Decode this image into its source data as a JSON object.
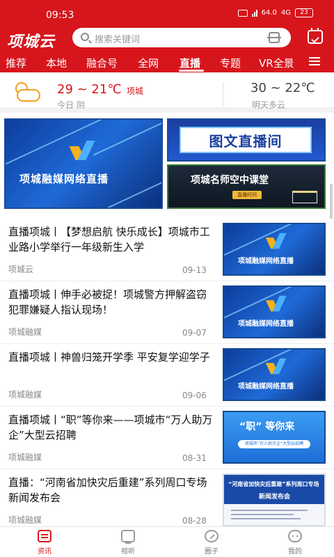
{
  "status_bar": {
    "time": "09:53",
    "battery": "23",
    "network": "4G",
    "speed": "64.0"
  },
  "app": {
    "logo": "项城云",
    "accent": "#d7151c"
  },
  "search": {
    "placeholder": "搜索关键词"
  },
  "tabs": [
    {
      "label": "推荐"
    },
    {
      "label": "本地"
    },
    {
      "label": "融合号"
    },
    {
      "label": "全网"
    },
    {
      "label": "直播",
      "active": true
    },
    {
      "label": "专题"
    },
    {
      "label": "VR全景"
    }
  ],
  "weather": {
    "today_temp": "29 ~ 21℃",
    "city": "项城",
    "today_desc": "今日 阴",
    "tomorrow_temp": "30 ~ 22℃",
    "tomorrow_desc": "明天多云"
  },
  "banners": {
    "main": "项城融媒网络直播",
    "top_right": "图文直播间",
    "bottom_right": "项城名师空中课堂",
    "bottom_right_tag": "直播时间"
  },
  "news": [
    {
      "title": "直播项城丨【梦想启航 快乐成长】项城市工业路小学举行一年级新生入学",
      "source": "项城云",
      "date": "09-13",
      "thumb": "项城融媒网络直播"
    },
    {
      "title": "直播项城丨伸手必被捉！项城警方押解盗窃犯罪嫌疑人指认现场！",
      "source": "项城融媒",
      "date": "09-07",
      "thumb": "项城融媒网络直播"
    },
    {
      "title": "直播项城丨神兽归笼开学季 平安复学迎学子",
      "source": "项城融媒",
      "date": "09-06",
      "thumb": "项城融媒网络直播"
    },
    {
      "title": "直播项城丨“职”等你来——项城市“万人助万企”大型云招聘",
      "source": "项城融媒",
      "date": "08-31",
      "thumb": "“职” 等你来",
      "thumb_sub": "项城市“万人助万企”大型云招聘"
    },
    {
      "title": "直播：“河南省加快灾后重建”系列周口专场新闻发布会",
      "source": "项城融媒",
      "date": "08-28",
      "thumb": "“河南省加快灾后重建”系列周口专场",
      "thumb_sub": "新闻发布会"
    }
  ],
  "bottom_nav": [
    {
      "label": "资讯",
      "icon": "news-icon",
      "active": true
    },
    {
      "label": "视听",
      "icon": "tv-icon"
    },
    {
      "label": "圈子",
      "icon": "circle-icon"
    },
    {
      "label": "我的",
      "icon": "profile-icon"
    }
  ]
}
